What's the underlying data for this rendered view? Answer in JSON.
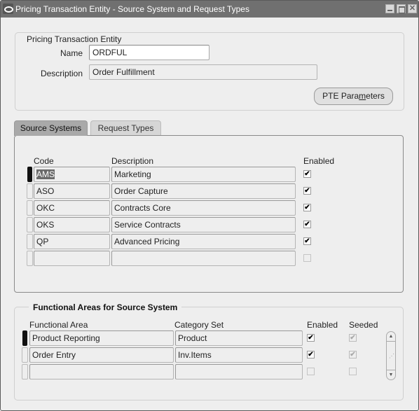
{
  "window": {
    "title": "Pricing Transaction Entity - Source System and Request Types",
    "controls": {
      "minimize": "minimize",
      "maximize": "maximize",
      "close": "✕"
    }
  },
  "pte": {
    "group_label": "Pricing Transaction Entity",
    "name_label": "Name",
    "name_value": "ORDFUL",
    "description_label": "Description",
    "description_value": "Order Fulfillment",
    "params_button": {
      "before": "PTE Para",
      "mnemonic": "m",
      "after": "eters"
    }
  },
  "tabs": [
    {
      "label": "Source Systems",
      "active": true
    },
    {
      "label": "Request Types",
      "active": false
    }
  ],
  "source_systems": {
    "columns": {
      "code": "Code",
      "description": "Description",
      "enabled": "Enabled"
    },
    "rows": [
      {
        "code": "AMS",
        "description": "Marketing",
        "enabled": true,
        "current": true
      },
      {
        "code": "ASO",
        "description": "Order Capture",
        "enabled": true,
        "current": false
      },
      {
        "code": "OKC",
        "description": "Contracts Core",
        "enabled": true,
        "current": false
      },
      {
        "code": "OKS",
        "description": "Service Contracts",
        "enabled": true,
        "current": false
      },
      {
        "code": "QP",
        "description": "Advanced Pricing",
        "enabled": true,
        "current": false
      },
      {
        "code": "",
        "description": "",
        "enabled": false,
        "current": false
      }
    ]
  },
  "functional_areas": {
    "title": "Functional Areas for Source System",
    "columns": {
      "area": "Functional Area",
      "category_set": "Category Set",
      "enabled": "Enabled",
      "seeded": "Seeded"
    },
    "rows": [
      {
        "area": "Product Reporting",
        "category_set": "Product",
        "enabled": true,
        "seeded": true,
        "current": true
      },
      {
        "area": "Order Entry",
        "category_set": "Inv.Items",
        "enabled": true,
        "seeded": true,
        "current": false
      },
      {
        "area": "",
        "category_set": "",
        "enabled": false,
        "seeded": false,
        "current": false
      }
    ],
    "scroll_up": "▲",
    "scroll_down": "▼"
  },
  "check_glyph": "✔"
}
